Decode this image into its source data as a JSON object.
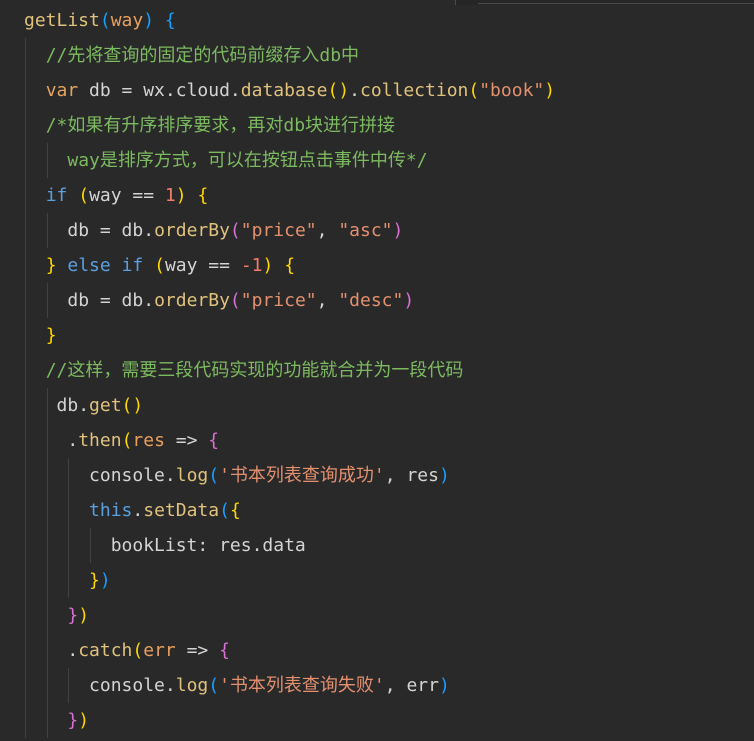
{
  "theme": {
    "background": "#292929",
    "indent_guide": "#414141"
  },
  "lines": [
    {
      "indent": "",
      "tokens": [
        {
          "text": "getList",
          "color": "#e0c27d"
        },
        {
          "text": "(",
          "color": "#179fff"
        },
        {
          "text": "way",
          "color": "#ea9f5e"
        },
        {
          "text": ")",
          "color": "#179fff"
        },
        {
          "text": " ",
          "color": "#d4d4d4"
        },
        {
          "text": "{",
          "color": "#179fff"
        }
      ]
    },
    {
      "indent": "  ",
      "tokens": [
        {
          "text": "//先将查询的固定的代码前缀存入db中",
          "color": "#7cba60"
        }
      ]
    },
    {
      "indent": "  ",
      "tokens": [
        {
          "text": "var",
          "color": "#e5a45f"
        },
        {
          "text": " db = wx.cloud.",
          "color": "#d4d4d4"
        },
        {
          "text": "database",
          "color": "#e0c27d"
        },
        {
          "text": "(",
          "color": "#ffd700"
        },
        {
          "text": ")",
          "color": "#ffd700"
        },
        {
          "text": ".",
          "color": "#d4d4d4"
        },
        {
          "text": "collection",
          "color": "#e0c27d"
        },
        {
          "text": "(",
          "color": "#ffd700"
        },
        {
          "text": "\"book\"",
          "color": "#e3906f"
        },
        {
          "text": ")",
          "color": "#ffd700"
        }
      ]
    },
    {
      "indent": "  ",
      "tokens": [
        {
          "text": "/*如果有升序排序要求，再对db块进行拼接",
          "color": "#7cba60"
        }
      ]
    },
    {
      "indent": "    ",
      "tokens": [
        {
          "text": "way是排序方式，可以在按钮点击事件中传*/",
          "color": "#7cba60"
        }
      ]
    },
    {
      "indent": "  ",
      "tokens": [
        {
          "text": "if",
          "color": "#5aa0e0"
        },
        {
          "text": " ",
          "color": "#d4d4d4"
        },
        {
          "text": "(",
          "color": "#ffd700"
        },
        {
          "text": "way == ",
          "color": "#d4d4d4"
        },
        {
          "text": "1",
          "color": "#f27c6a"
        },
        {
          "text": ")",
          "color": "#ffd700"
        },
        {
          "text": " ",
          "color": "#d4d4d4"
        },
        {
          "text": "{",
          "color": "#ffd700"
        }
      ]
    },
    {
      "indent": "    ",
      "tokens": [
        {
          "text": "db = db.",
          "color": "#d4d4d4"
        },
        {
          "text": "orderBy",
          "color": "#e0c27d"
        },
        {
          "text": "(",
          "color": "#da70d6"
        },
        {
          "text": "\"price\"",
          "color": "#e3906f"
        },
        {
          "text": ", ",
          "color": "#d4d4d4"
        },
        {
          "text": "\"asc\"",
          "color": "#e3906f"
        },
        {
          "text": ")",
          "color": "#da70d6"
        }
      ]
    },
    {
      "indent": "  ",
      "tokens": [
        {
          "text": "}",
          "color": "#ffd700"
        },
        {
          "text": " ",
          "color": "#d4d4d4"
        },
        {
          "text": "else",
          "color": "#5aa0e0"
        },
        {
          "text": " ",
          "color": "#d4d4d4"
        },
        {
          "text": "if",
          "color": "#5aa0e0"
        },
        {
          "text": " ",
          "color": "#d4d4d4"
        },
        {
          "text": "(",
          "color": "#ffd700"
        },
        {
          "text": "way == ",
          "color": "#d4d4d4"
        },
        {
          "text": "-1",
          "color": "#f27c6a"
        },
        {
          "text": ")",
          "color": "#ffd700"
        },
        {
          "text": " ",
          "color": "#d4d4d4"
        },
        {
          "text": "{",
          "color": "#ffd700"
        }
      ]
    },
    {
      "indent": "    ",
      "tokens": [
        {
          "text": "db = db.",
          "color": "#d4d4d4"
        },
        {
          "text": "orderBy",
          "color": "#e0c27d"
        },
        {
          "text": "(",
          "color": "#da70d6"
        },
        {
          "text": "\"price\"",
          "color": "#e3906f"
        },
        {
          "text": ", ",
          "color": "#d4d4d4"
        },
        {
          "text": "\"desc\"",
          "color": "#e3906f"
        },
        {
          "text": ")",
          "color": "#da70d6"
        }
      ]
    },
    {
      "indent": "  ",
      "tokens": [
        {
          "text": "}",
          "color": "#ffd700"
        }
      ]
    },
    {
      "indent": "  ",
      "tokens": [
        {
          "text": "//这样，需要三段代码实现的功能就合并为一段代码",
          "color": "#7cba60"
        }
      ]
    },
    {
      "indent": "   ",
      "tokens": [
        {
          "text": "db.",
          "color": "#d4d4d4"
        },
        {
          "text": "get",
          "color": "#e0c27d"
        },
        {
          "text": "(",
          "color": "#ffd700"
        },
        {
          "text": ")",
          "color": "#ffd700"
        }
      ]
    },
    {
      "indent": "    ",
      "tokens": [
        {
          "text": ".",
          "color": "#d4d4d4"
        },
        {
          "text": "then",
          "color": "#e0c27d"
        },
        {
          "text": "(",
          "color": "#ffd700"
        },
        {
          "text": "res",
          "color": "#ea9f5e"
        },
        {
          "text": " => ",
          "color": "#d4d4d4"
        },
        {
          "text": "{",
          "color": "#da70d6"
        }
      ]
    },
    {
      "indent": "      ",
      "tokens": [
        {
          "text": "console.",
          "color": "#d4d4d4"
        },
        {
          "text": "log",
          "color": "#e0c27d"
        },
        {
          "text": "(",
          "color": "#179fff"
        },
        {
          "text": "'书本列表查询成功'",
          "color": "#e3906f"
        },
        {
          "text": ", res",
          "color": "#d4d4d4"
        },
        {
          "text": ")",
          "color": "#179fff"
        }
      ]
    },
    {
      "indent": "      ",
      "tokens": [
        {
          "text": "this",
          "color": "#5aa0e0"
        },
        {
          "text": ".",
          "color": "#d4d4d4"
        },
        {
          "text": "setData",
          "color": "#e0c27d"
        },
        {
          "text": "(",
          "color": "#179fff"
        },
        {
          "text": "{",
          "color": "#ffd700"
        }
      ]
    },
    {
      "indent": "        ",
      "tokens": [
        {
          "text": "bookList: res.data",
          "color": "#d4d4d4"
        }
      ]
    },
    {
      "indent": "      ",
      "tokens": [
        {
          "text": "}",
          "color": "#ffd700"
        },
        {
          "text": ")",
          "color": "#179fff"
        }
      ]
    },
    {
      "indent": "    ",
      "tokens": [
        {
          "text": "}",
          "color": "#da70d6"
        },
        {
          "text": ")",
          "color": "#ffd700"
        }
      ]
    },
    {
      "indent": "    ",
      "tokens": [
        {
          "text": ".",
          "color": "#d4d4d4"
        },
        {
          "text": "catch",
          "color": "#e0c27d"
        },
        {
          "text": "(",
          "color": "#ffd700"
        },
        {
          "text": "err",
          "color": "#ea9f5e"
        },
        {
          "text": " => ",
          "color": "#d4d4d4"
        },
        {
          "text": "{",
          "color": "#da70d6"
        }
      ]
    },
    {
      "indent": "      ",
      "tokens": [
        {
          "text": "console.",
          "color": "#d4d4d4"
        },
        {
          "text": "log",
          "color": "#e0c27d"
        },
        {
          "text": "(",
          "color": "#179fff"
        },
        {
          "text": "'书本列表查询失败'",
          "color": "#e3906f"
        },
        {
          "text": ", err",
          "color": "#d4d4d4"
        },
        {
          "text": ")",
          "color": "#179fff"
        }
      ]
    },
    {
      "indent": "    ",
      "tokens": [
        {
          "text": "}",
          "color": "#da70d6"
        },
        {
          "text": ")",
          "color": "#ffd700"
        }
      ]
    }
  ]
}
